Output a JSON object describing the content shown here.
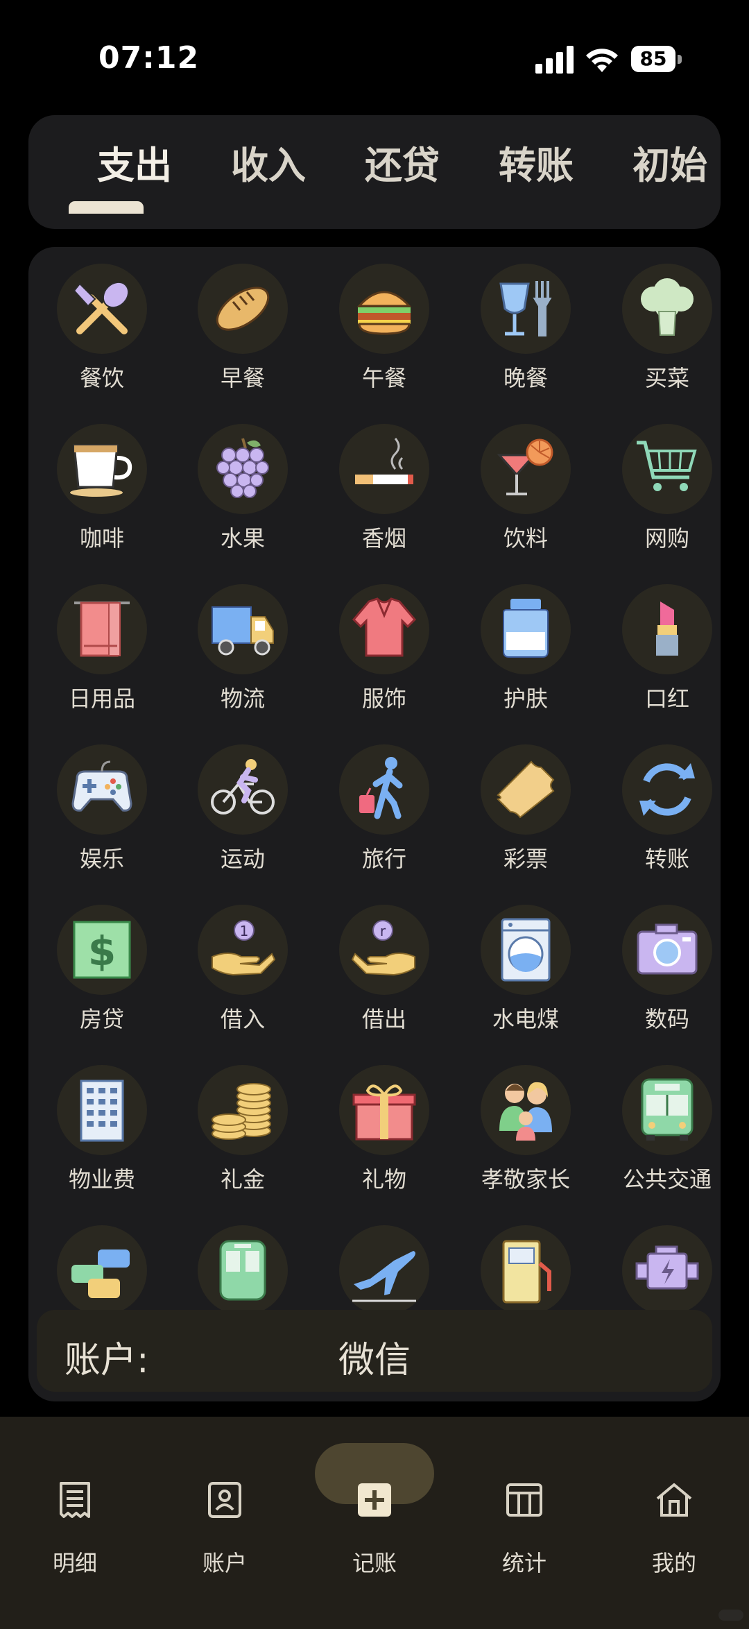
{
  "status_bar": {
    "time": "07:12",
    "battery": "85"
  },
  "tabs": [
    {
      "label": "支出",
      "active": true
    },
    {
      "label": "收入"
    },
    {
      "label": "还贷"
    },
    {
      "label": "转账"
    },
    {
      "label": "初始"
    }
  ],
  "categories": [
    {
      "label": "餐饮",
      "icon": "utensils-icon"
    },
    {
      "label": "早餐",
      "icon": "bread-icon"
    },
    {
      "label": "午餐",
      "icon": "burger-icon"
    },
    {
      "label": "晚餐",
      "icon": "wineglass-fork-icon"
    },
    {
      "label": "买菜",
      "icon": "broccoli-icon"
    },
    {
      "label": "咖啡",
      "icon": "coffee-cup-icon"
    },
    {
      "label": "水果",
      "icon": "grapes-icon"
    },
    {
      "label": "香烟",
      "icon": "cigarette-icon"
    },
    {
      "label": "饮料",
      "icon": "cocktail-icon"
    },
    {
      "label": "网购",
      "icon": "shopping-cart-icon"
    },
    {
      "label": "日用品",
      "icon": "towel-icon"
    },
    {
      "label": "物流",
      "icon": "truck-icon"
    },
    {
      "label": "服饰",
      "icon": "sweater-icon"
    },
    {
      "label": "护肤",
      "icon": "cream-jar-icon"
    },
    {
      "label": "口红",
      "icon": "lipstick-icon"
    },
    {
      "label": "娱乐",
      "icon": "gamepad-icon"
    },
    {
      "label": "运动",
      "icon": "cyclist-icon"
    },
    {
      "label": "旅行",
      "icon": "traveler-icon"
    },
    {
      "label": "彩票",
      "icon": "ticket-icon"
    },
    {
      "label": "转账",
      "icon": "refresh-icon"
    },
    {
      "label": "房贷",
      "icon": "dollar-bill-icon"
    },
    {
      "label": "借入",
      "icon": "hand-coin-in-icon"
    },
    {
      "label": "借出",
      "icon": "hand-coin-out-icon"
    },
    {
      "label": "水电煤",
      "icon": "washing-machine-icon"
    },
    {
      "label": "数码",
      "icon": "camera-icon"
    },
    {
      "label": "物业费",
      "icon": "building-icon"
    },
    {
      "label": "礼金",
      "icon": "coins-icon"
    },
    {
      "label": "礼物",
      "icon": "gift-icon"
    },
    {
      "label": "孝敬家长",
      "icon": "family-icon"
    },
    {
      "label": "公共交通",
      "icon": "bus-icon"
    },
    {
      "label": "",
      "icon": "cars-icon"
    },
    {
      "label": "",
      "icon": "train-icon"
    },
    {
      "label": "",
      "icon": "airplane-icon"
    },
    {
      "label": "",
      "icon": "fuel-pump-icon"
    },
    {
      "label": "",
      "icon": "engine-icon"
    }
  ],
  "account": {
    "label": "账户:",
    "value": "微信"
  },
  "bottom_nav": [
    {
      "label": "明细",
      "icon": "receipt-icon"
    },
    {
      "label": "账户",
      "icon": "account-book-icon"
    },
    {
      "label": "记账",
      "icon": "add-square-icon",
      "active": true
    },
    {
      "label": "统计",
      "icon": "table-chart-icon"
    },
    {
      "label": "我的",
      "icon": "home-icon"
    }
  ]
}
